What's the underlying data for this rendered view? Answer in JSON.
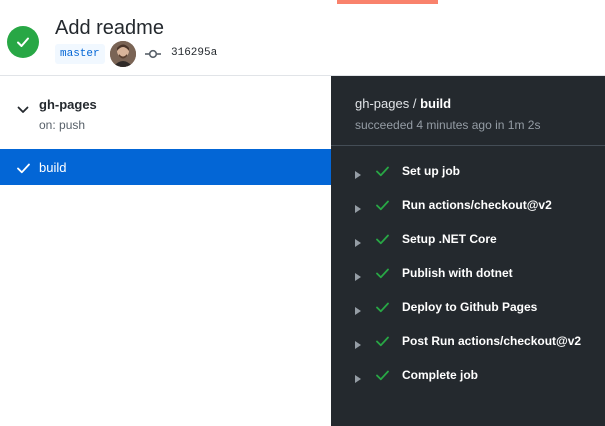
{
  "header": {
    "commit_title": "Add readme",
    "branch": "master",
    "commit_sha": "316295a"
  },
  "workflow": {
    "name": "gh-pages",
    "trigger": "on: push",
    "job": "build"
  },
  "job_panel": {
    "workflow": "gh-pages",
    "separator": " / ",
    "job": "build",
    "status": "succeeded 4 minutes ago in 1m 2s",
    "steps": [
      {
        "label": "Set up job"
      },
      {
        "label": "Run actions/checkout@v2"
      },
      {
        "label": "Setup .NET Core"
      },
      {
        "label": "Publish with dotnet"
      },
      {
        "label": "Deploy to Github Pages"
      },
      {
        "label": "Post Run actions/checkout@v2"
      },
      {
        "label": "Complete job"
      }
    ]
  },
  "colors": {
    "success": "#28a745",
    "selected": "#0366d6",
    "dark_panel": "#24292e",
    "tab_accent": "#f9826c"
  }
}
